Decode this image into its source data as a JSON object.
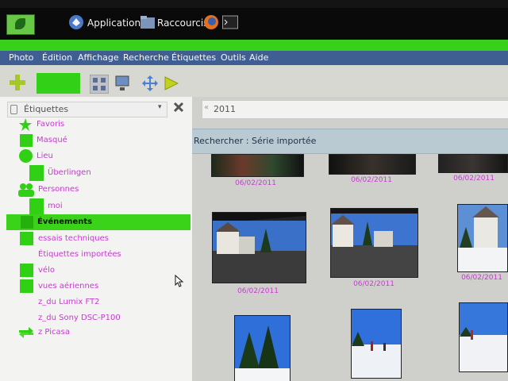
{
  "panel": {
    "applications": "Applications",
    "shortcuts": "Raccourcis"
  },
  "menubar": {
    "items": [
      "Photo",
      "Édition",
      "Affichage",
      "Recherche",
      "Étiquettes",
      "Outils",
      "Aide"
    ]
  },
  "sidebar": {
    "combo": "Étiquettes",
    "items": [
      {
        "label": "Favoris"
      },
      {
        "label": "Masqué"
      },
      {
        "label": "Lieu"
      },
      {
        "label": "Überlingen"
      },
      {
        "label": "Personnes"
      },
      {
        "label": "moi"
      },
      {
        "label": "Événements",
        "selected": true
      },
      {
        "label": "essais techniques"
      },
      {
        "label": "Étiquettes importées"
      },
      {
        "label": "vélo"
      },
      {
        "label": "vues aériennes"
      },
      {
        "label": "z_du Lumix FT2"
      },
      {
        "label": "z_du Sony DSC-P100"
      },
      {
        "label": "z Picasa"
      }
    ]
  },
  "search": {
    "value": "2011"
  },
  "infobar": {
    "text": "Rechercher :  Série importée"
  },
  "photos": [
    {
      "date": "06/02/2011"
    },
    {
      "date": "06/02/2011"
    },
    {
      "date": "06/02/2011"
    },
    {
      "date": "06/02/2011"
    },
    {
      "date": "06/02/2011"
    },
    {
      "date": "06/02/2011"
    },
    {
      "date": ""
    },
    {
      "date": ""
    },
    {
      "date": ""
    }
  ],
  "colors": {
    "accent_green": "#37d11b",
    "menubar": "#3f5f93",
    "label_purple": "#c63bd0"
  }
}
